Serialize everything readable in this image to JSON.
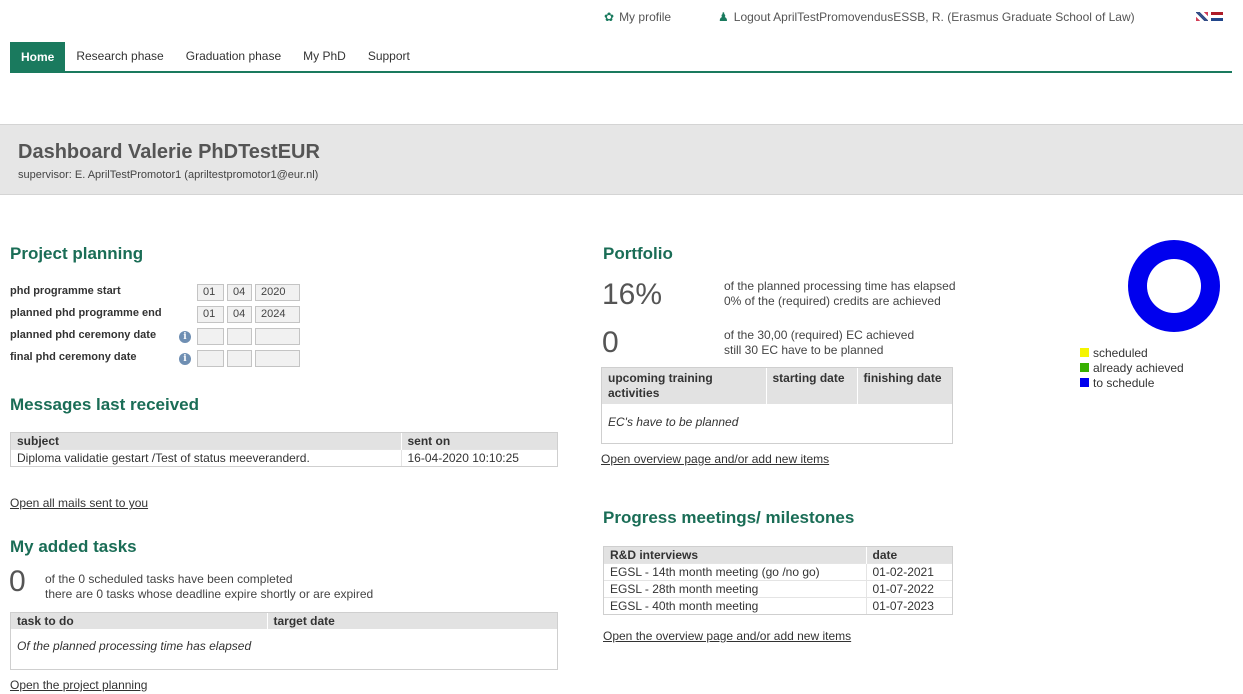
{
  "colors": {
    "brand": "#1a7a5e",
    "scheduled": "#f5f500",
    "achieved": "#38b000",
    "to_schedule": "#0000ee"
  },
  "topbar": {
    "profile_icon": "gear-icon",
    "profile_label": "My profile",
    "logout_icon": "user-icon",
    "logout_label": "Logout AprilTestPromovendusESSB, R. (Erasmus Graduate School of Law)"
  },
  "nav": {
    "home": "Home",
    "research": "Research phase",
    "graduation": "Graduation phase",
    "myphd": "My PhD",
    "support": "Support"
  },
  "header": {
    "title": "Dashboard Valerie PhDTestEUR",
    "supervisor": "supervisor: E. AprilTestPromotor1 (apriltestpromotor1@eur.nl)"
  },
  "planning": {
    "title": "Project planning",
    "rows": [
      {
        "label": "phd programme start",
        "day": "01",
        "month": "04",
        "year": "2020"
      },
      {
        "label": "planned phd programme end",
        "day": "01",
        "month": "04",
        "year": "2024"
      },
      {
        "label": "planned phd ceremony date",
        "day": "",
        "month": "",
        "year": ""
      },
      {
        "label": "final phd ceremony date",
        "day": "",
        "month": "",
        "year": ""
      }
    ]
  },
  "messages": {
    "title": "Messages last received",
    "col_subject": "subject",
    "col_sent": "sent on",
    "rows": [
      {
        "subject": "Diploma validatie gestart /Test of status meeveranderd.",
        "sent": "16-04-2020 10:10:25"
      }
    ],
    "link": "Open all mails sent to you"
  },
  "tasks": {
    "title": "My added tasks",
    "count": "0",
    "line1": "of the 0 scheduled tasks have been completed",
    "line2": "there are 0 tasks whose deadline expire shortly or are expired",
    "col_task": "task to do",
    "col_target": "target date",
    "empty": "Of the planned processing time has elapsed",
    "link": "Open the project planning"
  },
  "portfolio": {
    "title": "Portfolio",
    "percent": "16%",
    "line1": "of the planned processing time has elapsed",
    "line2": "0% of the (required) credits are achieved",
    "ec": "0",
    "line3": "of the 30,00 (required) EC achieved",
    "line4": "still 30 EC have to be planned",
    "col_activity_1": "upcoming training",
    "col_activity_2": "activities",
    "col_start": "starting date",
    "col_finish": "finishing date",
    "empty": "EC's have to be planned",
    "link": "Open overview page and/or add new items"
  },
  "chart_data": {
    "type": "pie",
    "categories": [
      "scheduled",
      "already achieved",
      "to schedule"
    ],
    "values": [
      0,
      0,
      30
    ],
    "legend": "bottom"
  },
  "progress": {
    "title": "Progress meetings/ milestones",
    "col_interview": "R&D interviews",
    "col_date": "date",
    "rows": [
      {
        "name": "EGSL - 14th month meeting (go /no go)",
        "date": "01-02-2021"
      },
      {
        "name": "EGSL - 28th month meeting",
        "date": "01-07-2022"
      },
      {
        "name": "EGSL - 40th month meeting",
        "date": "01-07-2023"
      }
    ],
    "link": "Open the overview page and/or add new items"
  }
}
